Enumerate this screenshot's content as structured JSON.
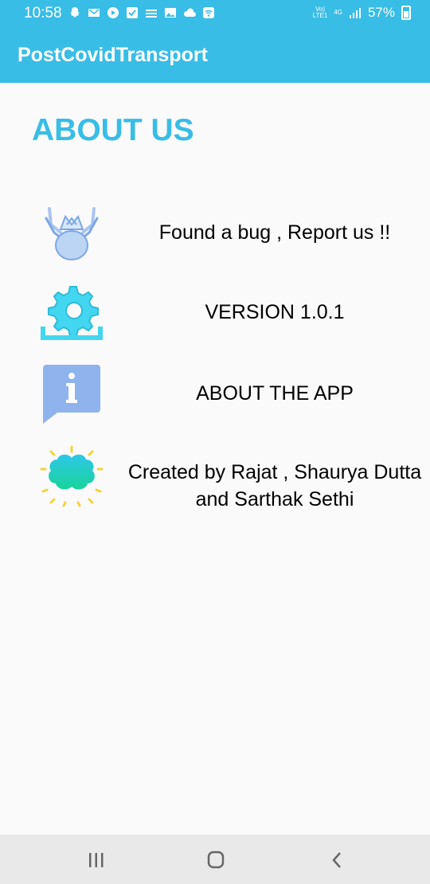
{
  "status_bar": {
    "time": "10:58",
    "network_top": "Vo)",
    "network_bottom": "LTE1",
    "network_type": "4G",
    "battery_percent": "57%",
    "icons": [
      "snapchat-icon",
      "gmail-icon",
      "play-icon",
      "check-icon",
      "app-icon",
      "gallery-icon",
      "cloud-icon",
      "wifi-icon"
    ]
  },
  "app_bar": {
    "title": "PostCovidTransport"
  },
  "page": {
    "heading": "ABOUT US",
    "items": [
      {
        "icon": "bug-icon",
        "label": "Found a bug , Report us !!"
      },
      {
        "icon": "settings-gear-icon",
        "label": "VERSION 1.0.1"
      },
      {
        "icon": "info-icon",
        "label": "ABOUT THE APP"
      },
      {
        "icon": "brain-icon",
        "label": "Created by Rajat , Shaurya Dutta and Sarthak Sethi"
      }
    ]
  },
  "colors": {
    "primary": "#38bde6",
    "background": "#fafafa",
    "nav_bar": "#e9e9e9"
  }
}
